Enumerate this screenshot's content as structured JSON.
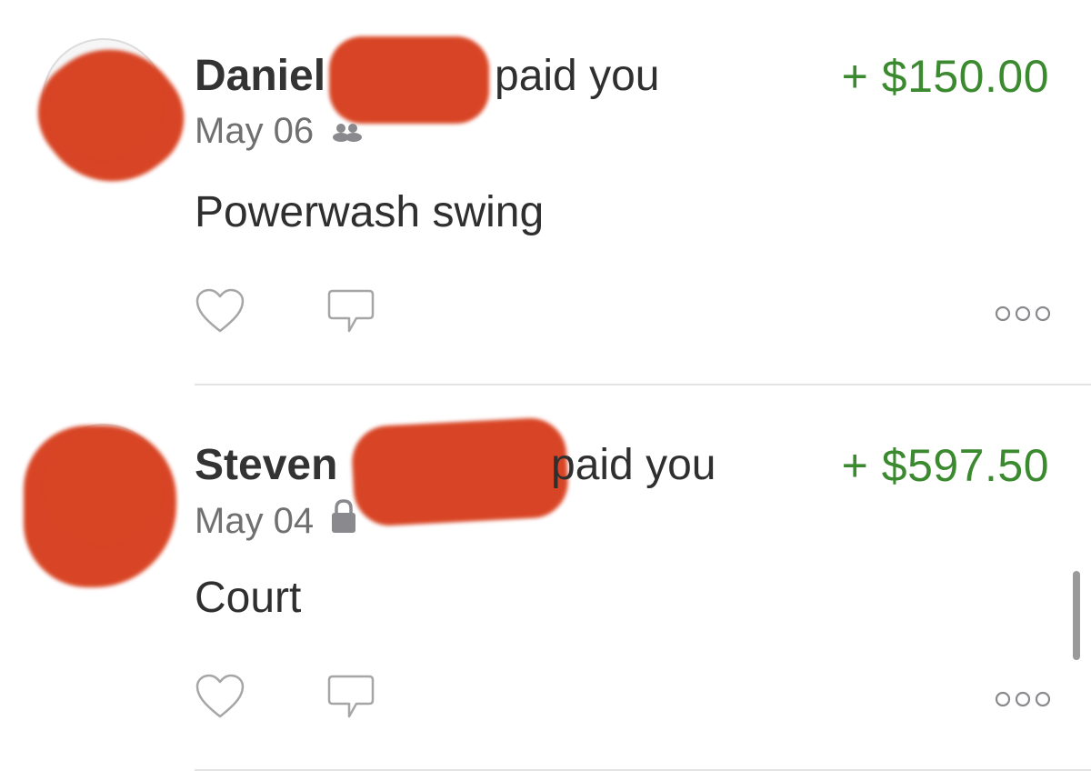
{
  "feed": {
    "transactions": [
      {
        "name": "Daniel",
        "action": "paid you",
        "amount": "+ $150.00",
        "date": "May 06",
        "privacy_icon": "friends-icon",
        "note": "Powerwash swing"
      },
      {
        "name": "Steven",
        "action": "paid you",
        "amount": "+ $597.50",
        "date": "May 04",
        "privacy_icon": "lock-icon",
        "note": "Court"
      }
    ],
    "colors": {
      "amount_green": "#3b8a2f",
      "redaction": "#d7401f",
      "icon_gray": "#8a8a8e"
    }
  }
}
